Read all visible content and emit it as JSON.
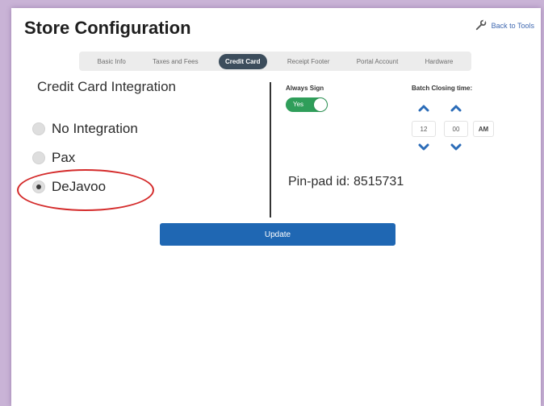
{
  "header": {
    "title": "Store Configuration",
    "back_label": "Back to Tools"
  },
  "tabs": [
    {
      "label": "Basic Info",
      "active": false
    },
    {
      "label": "Taxes and Fees",
      "active": false
    },
    {
      "label": "Credit Card",
      "active": true
    },
    {
      "label": "Receipt Footer",
      "active": false
    },
    {
      "label": "Portal Account",
      "active": false
    },
    {
      "label": "Hardware",
      "active": false
    }
  ],
  "credit_card": {
    "heading": "Credit Card Integration",
    "options": [
      {
        "label": "No Integration",
        "selected": false
      },
      {
        "label": "Pax",
        "selected": false
      },
      {
        "label": "DeJavoo",
        "selected": true
      }
    ]
  },
  "always_sign": {
    "label": "Always Sign",
    "toggle_text": "Yes",
    "on": true
  },
  "batch": {
    "label": "Batch Closing time:",
    "hour": "12",
    "minute": "00",
    "period": "AM"
  },
  "pinpad_text": "Pin-pad id: 8515731",
  "update_label": "Update",
  "colors": {
    "accent_button": "#1f67b3",
    "active_tab": "#3c4d5c",
    "toggle_on": "#2f9e5a",
    "arrow": "#2b6cb8",
    "highlight": "#d42a2a",
    "background": "#c9b3d6"
  },
  "icons": {
    "back": "wrench-icon",
    "up": "chevron-up-icon",
    "down": "chevron-down-icon"
  }
}
